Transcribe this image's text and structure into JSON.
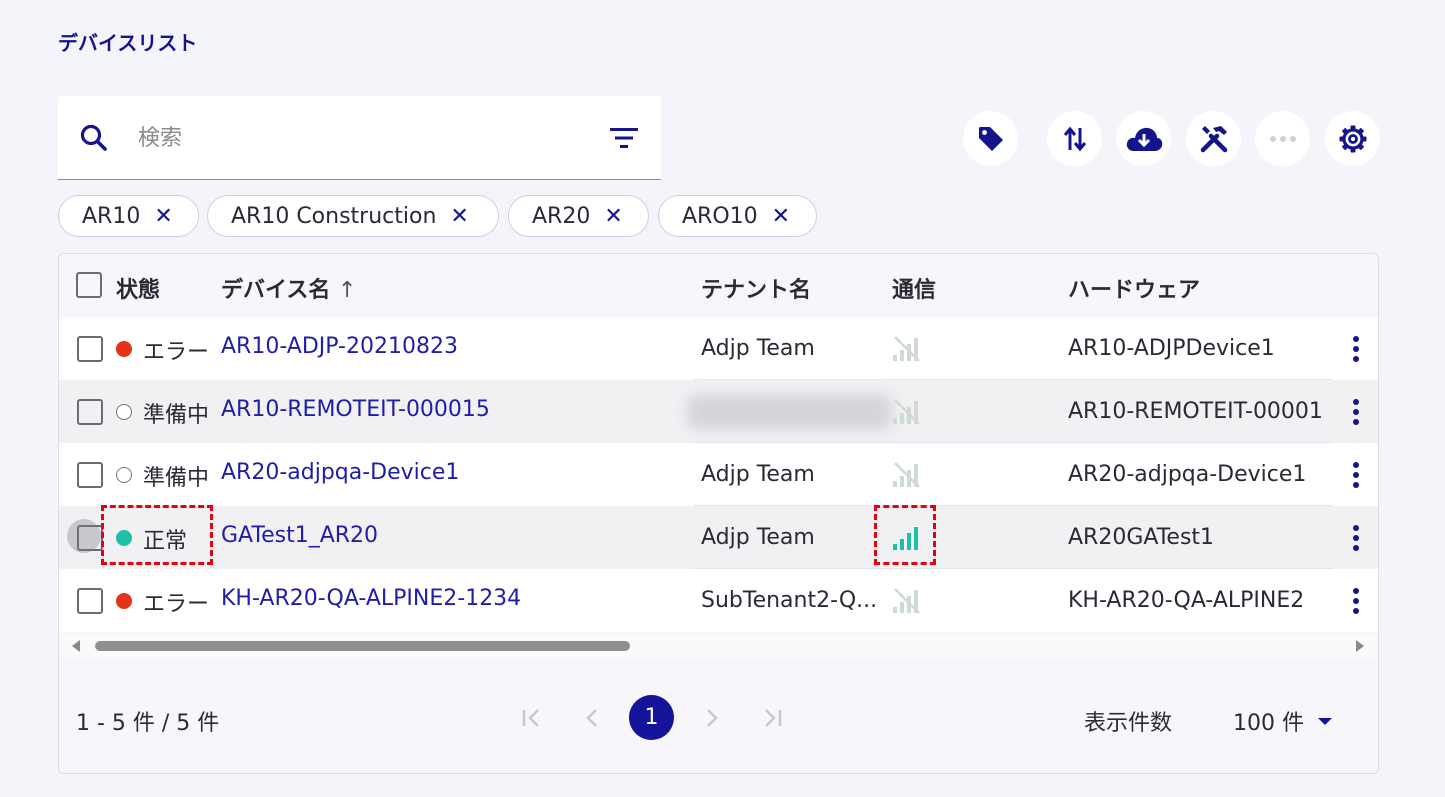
{
  "page": {
    "title": "デバイスリスト"
  },
  "search": {
    "placeholder": "検索"
  },
  "toolbar": {
    "icons": [
      "tag-icon",
      "sort-icon",
      "cloud-download-icon",
      "tools-icon",
      "more-horizontal-icon",
      "gear-icon"
    ],
    "accent_color": "#14148c"
  },
  "filter_chips": [
    "AR10",
    "AR10 Construction",
    "AR20",
    "ARO10"
  ],
  "chip_close_glyph": "✕",
  "table": {
    "columns": {
      "status": "状態",
      "device_name": "デバイス名",
      "sort_indicator": "↑",
      "tenant": "テナント名",
      "connection": "通信",
      "hardware": "ハードウェア"
    },
    "rows": [
      {
        "status": "エラー",
        "status_kind": "error",
        "device": "AR10-ADJP-20210823",
        "tenant": "Adjp Team",
        "signal": "no-signal",
        "hardware": "AR10-ADJPDevice1"
      },
      {
        "status": "準備中",
        "status_kind": "ready",
        "device": "AR10-REMOTEIT-000015",
        "tenant": "",
        "signal": "no-signal",
        "hardware": "AR10-REMOTEIT-00001"
      },
      {
        "status": "準備中",
        "status_kind": "ready",
        "device": "AR20-adjpqa-Device1",
        "tenant": "Adjp Team",
        "signal": "no-signal",
        "hardware": "AR20-adjpqa-Device1"
      },
      {
        "status": "正常",
        "status_kind": "ok",
        "device": "GATest1_AR20",
        "tenant": "Adjp Team",
        "signal": "full-signal",
        "hardware": "AR20GATest1"
      },
      {
        "status": "エラー",
        "status_kind": "error",
        "device": "KH-AR20-QA-ALPINE2-1234",
        "tenant": "SubTenant2-Q...",
        "signal": "no-signal",
        "hardware": "KH-AR20-QA-ALPINE2"
      }
    ],
    "status_colors": {
      "error": "#e63317",
      "ok": "#1fbfa8"
    }
  },
  "pagination": {
    "range_text": "1 - 5 件 / 5 件",
    "current_page": "1",
    "per_page_label": "表示件数",
    "per_page_value": "100 件"
  }
}
